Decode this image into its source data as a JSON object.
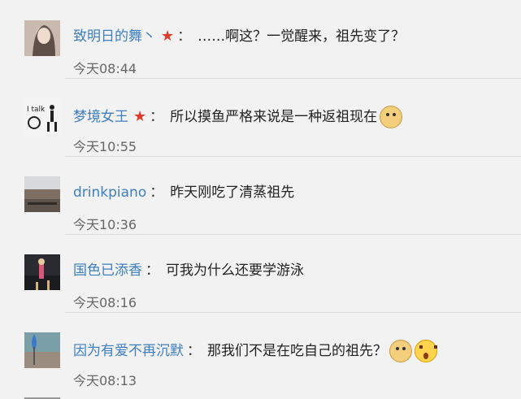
{
  "comments": [
    {
      "user": "致明日的舞丶",
      "star": "★",
      "sep": "：",
      "text": "……啊这？一觉醒来，祖先变了？",
      "time": "今天08:44",
      "emojis": []
    },
    {
      "user": "梦境女王",
      "star": "★",
      "sep": "：",
      "text": "所以摸鱼严格来说是一种返祖现在",
      "time": "今天10:55",
      "emojis": [
        "doge-emoji"
      ],
      "avatar_text": "I talk"
    },
    {
      "user": "drinkpiano",
      "star": "",
      "sep": "：",
      "text": "昨天刚吃了清蒸祖先",
      "time": "今天10:36",
      "emojis": []
    },
    {
      "user": "国色已添香",
      "star": "",
      "sep": "：",
      "text": "可我为什么还要学游泳",
      "time": "今天08:16",
      "emojis": []
    },
    {
      "user": "因为有爱不再沉默",
      "star": "",
      "sep": "：",
      "text": "那我们不是在吃自己的祖先？",
      "time": "今天08:13",
      "emojis": [
        "doge-emoji",
        "shocked-emoji"
      ]
    }
  ],
  "colors": {
    "username": "#3f7fbf",
    "star": "#e03b2a",
    "text": "#222222",
    "time": "#666666",
    "background": "#f2f2f2"
  }
}
